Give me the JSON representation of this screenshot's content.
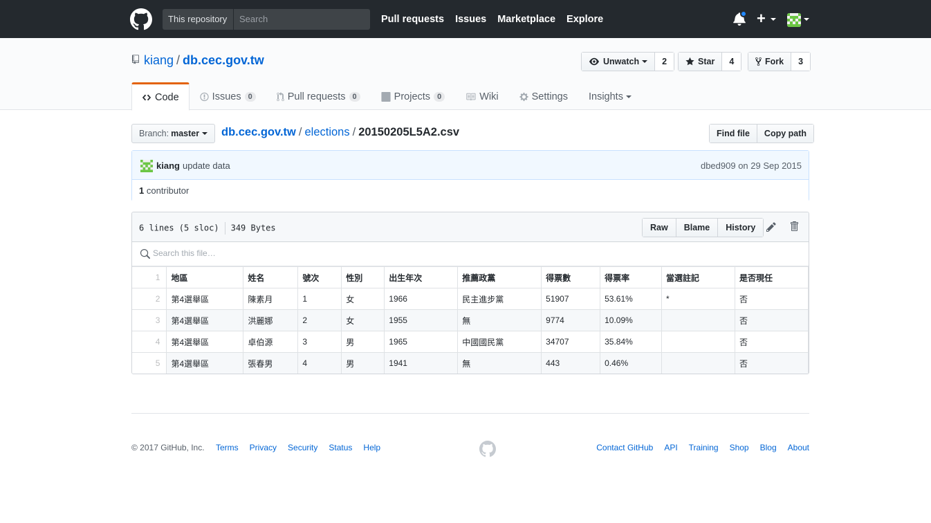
{
  "header": {
    "search_scope": "This repository",
    "search_placeholder": "Search",
    "nav": [
      "Pull requests",
      "Issues",
      "Marketplace",
      "Explore"
    ],
    "plus_label": "+"
  },
  "repo": {
    "owner": "kiang",
    "separator": "/",
    "name": "db.cec.gov.tw",
    "watch_label": "Unwatch",
    "watch_count": "2",
    "star_label": "Star",
    "star_count": "4",
    "fork_label": "Fork",
    "fork_count": "3"
  },
  "tabs": [
    {
      "label": "Code",
      "icon": "code-icon"
    },
    {
      "label": "Issues",
      "count": "0",
      "icon": "issue-opened-icon"
    },
    {
      "label": "Pull requests",
      "count": "0",
      "icon": "git-pull-request-icon"
    },
    {
      "label": "Projects",
      "count": "0",
      "icon": "project-icon"
    },
    {
      "label": "Wiki",
      "icon": "book-icon"
    },
    {
      "label": "Settings",
      "icon": "gear-icon"
    },
    {
      "label": "Insights",
      "icon": "none"
    }
  ],
  "breadcrumb": {
    "branch_prefix": "Branch:",
    "branch": "master",
    "root": "db.cec.gov.tw",
    "folder": "elections",
    "file": "20150205L5A2.csv",
    "find_file": "Find file",
    "copy_path": "Copy path"
  },
  "commit": {
    "author": "kiang",
    "message": "update data",
    "meta": "dbed909 on 29 Sep 2015",
    "contributor_count": "1",
    "contributor_label": "contributor"
  },
  "file": {
    "lines": "6 lines (5 sloc)",
    "size": "349 Bytes",
    "raw": "Raw",
    "blame": "Blame",
    "history": "History",
    "search_placeholder": "Search this file…"
  },
  "csv": {
    "headers": [
      "地區",
      "姓名",
      "號次",
      "性別",
      "出生年次",
      "推薦政黨",
      "得票數",
      "得票率",
      "當選註記",
      "是否現任"
    ],
    "rows": [
      [
        "第4選舉區",
        "陳素月",
        "1",
        "女",
        "1966",
        "民主進步黨",
        "51907",
        "53.61%",
        "*",
        "否"
      ],
      [
        "第4選舉區",
        "洪麗娜",
        "2",
        "女",
        "1955",
        "無",
        "9774",
        "10.09%",
        "",
        "否"
      ],
      [
        "第4選舉區",
        "卓伯源",
        "3",
        "男",
        "1965",
        "中國國民黨",
        "34707",
        "35.84%",
        "",
        "否"
      ],
      [
        "第4選舉區",
        "張春男",
        "4",
        "男",
        "1941",
        "無",
        "443",
        "0.46%",
        "",
        "否"
      ]
    ]
  },
  "footer": {
    "copyright": "© 2017 GitHub, Inc.",
    "left_links": [
      "Terms",
      "Privacy",
      "Security",
      "Status",
      "Help"
    ],
    "right_links": [
      "Contact GitHub",
      "API",
      "Training",
      "Shop",
      "Blog",
      "About"
    ]
  }
}
